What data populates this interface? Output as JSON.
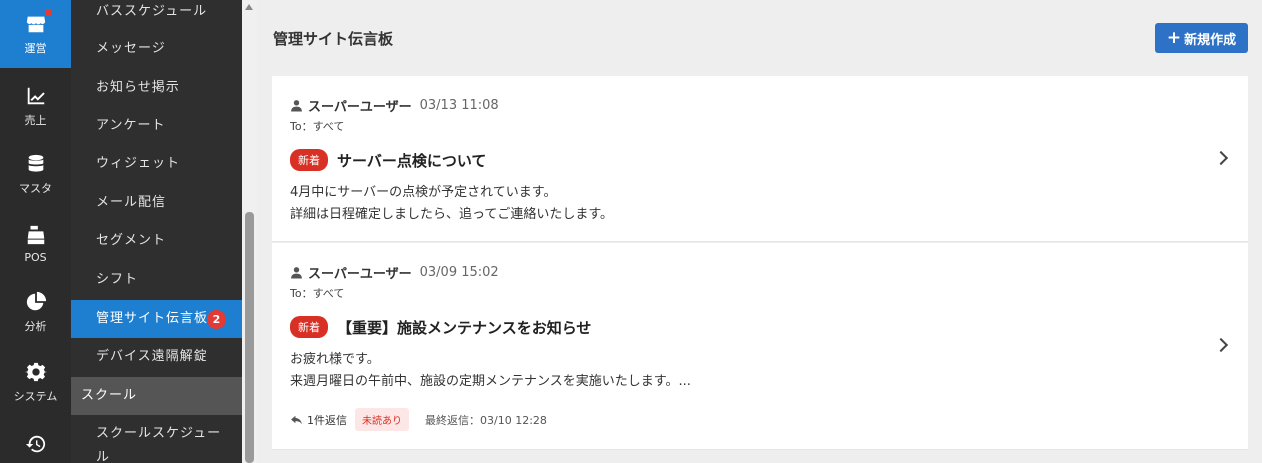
{
  "rail": [
    {
      "label": "運営",
      "icon": "store-icon",
      "active": true
    },
    {
      "label": "売上",
      "icon": "chart-line-icon"
    },
    {
      "label": "マスタ",
      "icon": "database-icon"
    },
    {
      "label": "POS",
      "icon": "cash-register-icon"
    },
    {
      "label": "分析",
      "icon": "pie-chart-icon"
    },
    {
      "label": "システム",
      "icon": "gear-icon"
    },
    {
      "label": "",
      "icon": "history-icon"
    }
  ],
  "submenu": {
    "items": [
      "バススケジュール",
      "メッセージ",
      "お知らせ掲示",
      "アンケート",
      "ウィジェット",
      "メール配信",
      "セグメント",
      "シフト",
      "管理サイト伝言板",
      "デバイス遠隔解錠"
    ],
    "active_badge": "2",
    "section": "スクール",
    "after_section": "スクールスケジュール"
  },
  "header": {
    "title": "管理サイト伝言板",
    "new_button": "新規作成"
  },
  "posts": [
    {
      "author": "スーパーユーザー",
      "time": "03/13 11:08",
      "to": "To：すべて",
      "badge": "新着",
      "title": "サーバー点検について",
      "body1": "4月中にサーバーの点検が予定されています。",
      "body2": "詳細は日程確定しましたら、追ってご連絡いたします。"
    },
    {
      "author": "スーパーユーザー",
      "time": "03/09 15:02",
      "to": "To：すべて",
      "badge": "新着",
      "title": "【重要】施設メンテナンスをお知らせ",
      "body1": "お疲れ様です。",
      "body2": "来週月曜日の午前中、施設の定期メンテナンスを実施いたします。...",
      "reply": "1件返信",
      "unread": "未読あり",
      "last_reply": "最終返信：03/10 12:28"
    }
  ]
}
